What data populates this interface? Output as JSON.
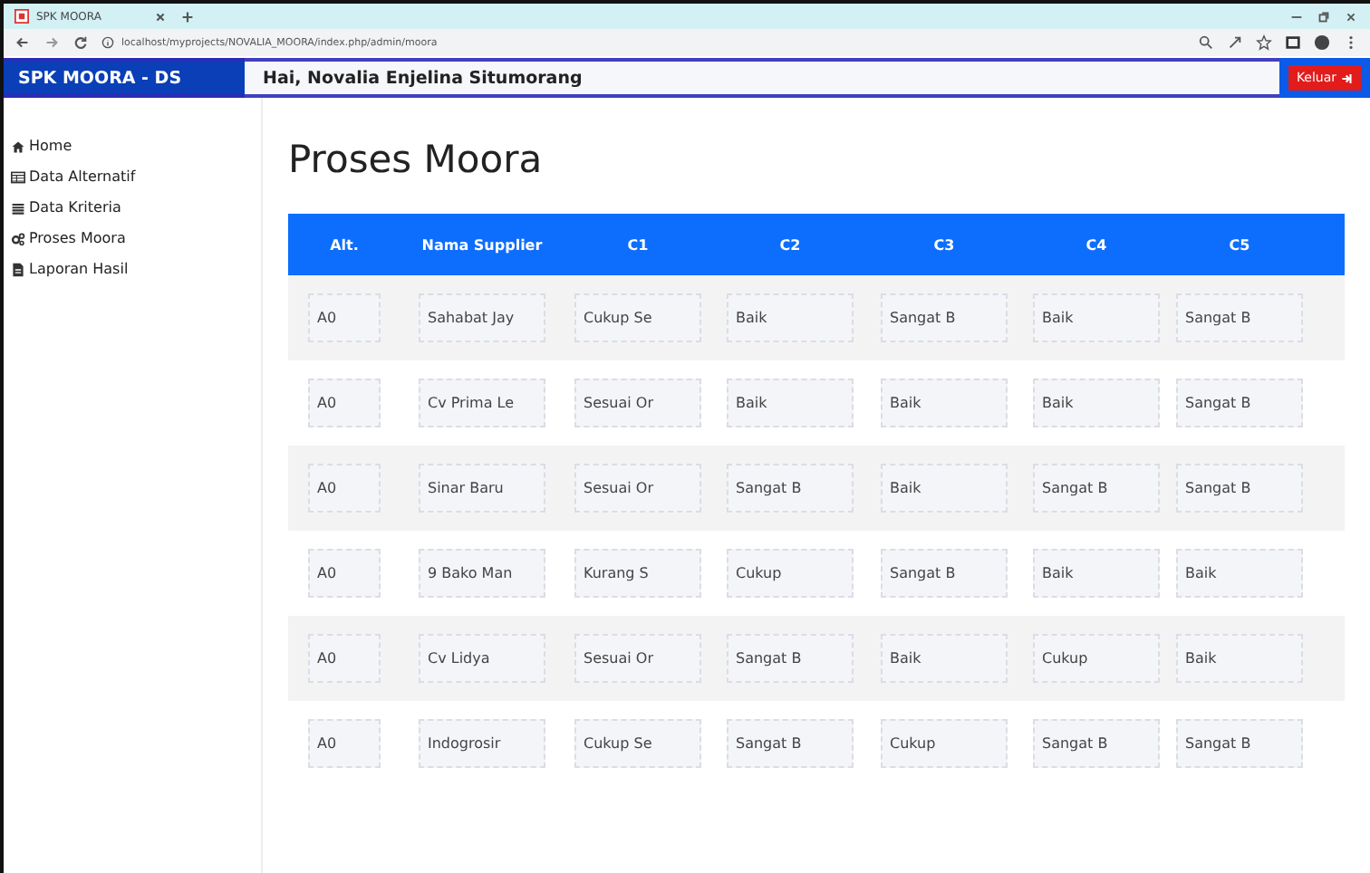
{
  "browser": {
    "tab_title": "SPK MOORA",
    "url": "localhost/myprojects/NOVALIA_MOORA/index.php/admin/moora"
  },
  "navbar": {
    "brand": "SPK MOORA - DS",
    "greeting": "Hai, Novalia Enjelina Situmorang",
    "logout": "Keluar"
  },
  "sidebar": {
    "items": [
      {
        "label": "Home"
      },
      {
        "label": "Data Alternatif"
      },
      {
        "label": "Data Kriteria"
      },
      {
        "label": "Proses Moora"
      },
      {
        "label": "Laporan Hasil"
      }
    ]
  },
  "page_title": "Proses Moora",
  "table": {
    "columns": [
      "Alt.",
      "Nama Supplier",
      "C1",
      "C2",
      "C3",
      "C4",
      "C5"
    ],
    "rows": [
      [
        "A0",
        "Sahabat Jay",
        "Cukup Se",
        "Baik",
        "Sangat B",
        "Baik",
        "Sangat B"
      ],
      [
        "A0",
        "Cv Prima Le",
        "Sesuai Or",
        "Baik",
        "Baik",
        "Baik",
        "Sangat B"
      ],
      [
        "A0",
        "Sinar Baru",
        "Sesuai Or",
        "Sangat B",
        "Baik",
        "Sangat B",
        "Sangat B"
      ],
      [
        "A0",
        "9 Bako Man",
        "Kurang S",
        "Cukup",
        "Sangat B",
        "Baik",
        "Baik"
      ],
      [
        "A0",
        "Cv Lidya",
        "Sesuai Or",
        "Sangat B",
        "Baik",
        "Cukup",
        "Baik"
      ],
      [
        "A0",
        "Indogrosir",
        "Cukup Se",
        "Sangat B",
        "Cukup",
        "Sangat B",
        "Sangat B"
      ]
    ]
  }
}
